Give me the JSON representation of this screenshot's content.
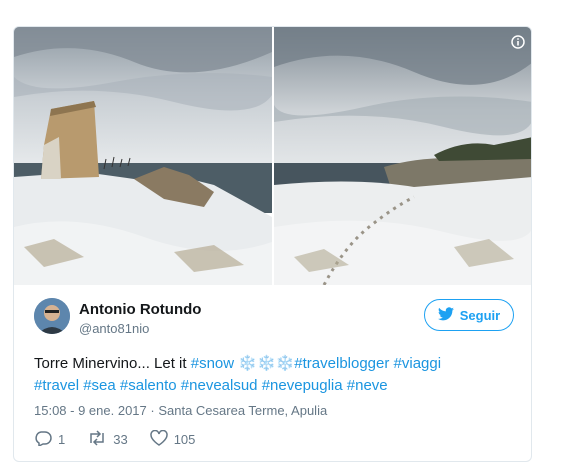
{
  "tweet": {
    "author_name": "Antonio Rotundo",
    "author_handle": "@anto81nio",
    "follow_label": "Seguir",
    "text_lines": [
      [
        {
          "type": "text",
          "value": "Torre Minervino... Let it "
        },
        {
          "type": "tag",
          "value": "#snow"
        },
        {
          "type": "snow",
          "value": " ❄️❄️❄️"
        },
        {
          "type": "tag",
          "value": "#travelblogger"
        },
        {
          "type": "text",
          "value": " "
        },
        {
          "type": "tag",
          "value": "#viaggi"
        }
      ],
      [
        {
          "type": "tag",
          "value": "#travel"
        },
        {
          "type": "text",
          "value": " "
        },
        {
          "type": "tag",
          "value": "#sea"
        },
        {
          "type": "text",
          "value": " "
        },
        {
          "type": "tag",
          "value": "#salento"
        },
        {
          "type": "text",
          "value": " "
        },
        {
          "type": "tag",
          "value": "#nevealsud"
        },
        {
          "type": "text",
          "value": " "
        },
        {
          "type": "tag",
          "value": "#nevepuglia"
        },
        {
          "type": "text",
          "value": " "
        },
        {
          "type": "tag",
          "value": "#neve"
        }
      ]
    ],
    "timestamp": "15:08 - 9 ene. 2017",
    "separator": " · ",
    "location": "Santa Cesarea Terme, Apulia",
    "replies": "1",
    "retweets": "33",
    "likes": "105"
  },
  "colors": {
    "accent": "#1da1f2",
    "link": "#1b95e0",
    "muted": "#657786",
    "border": "#e1e8ed"
  },
  "icons": {
    "info": "info-icon",
    "twitter": "twitter-bird-icon",
    "reply": "reply-icon",
    "retweet": "retweet-icon",
    "like": "heart-icon"
  }
}
